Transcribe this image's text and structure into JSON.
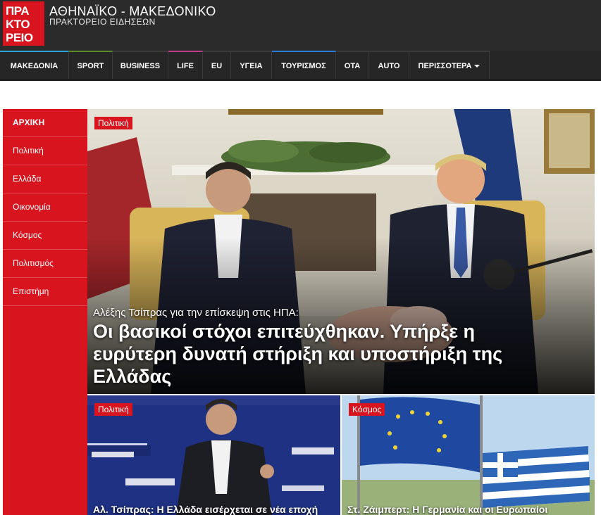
{
  "header": {
    "logo_lines": [
      "ΠΡΑ",
      "ΚΤΟ",
      "ΡΕΙΟ"
    ],
    "title": "ΑΘΗΝΑΪΚΟ - ΜΑΚΕΔΟΝΙΚΟ",
    "subtitle": "ΠΡΑΚΤΟΡΕΙΟ ΕΙΔΗΣΕΩΝ"
  },
  "nav": {
    "items": [
      {
        "label": "ΜΑΚΕΔΟΝΙΑ",
        "accent": "#2aa4d8"
      },
      {
        "label": "SPORT",
        "accent": "#5a8d2a"
      },
      {
        "label": "BUSINESS",
        "accent": "#3a3a3a"
      },
      {
        "label": "LIFE",
        "accent": "#c23a8a"
      },
      {
        "label": "EU",
        "accent": "#3a3a3a"
      },
      {
        "label": "ΥΓΕΙΑ",
        "accent": "#3a3a3a"
      },
      {
        "label": "ΤΟΥΡΙΣΜΟΣ",
        "accent": "#2a7ad8"
      },
      {
        "label": "ΟΤΑ",
        "accent": "#3a3a3a"
      },
      {
        "label": "AUTO",
        "accent": "#3a3a3a"
      },
      {
        "label": "ΠΕΡΙΣΣΟΤΕΡΑ",
        "accent": "#3a3a3a"
      }
    ]
  },
  "sidebar": {
    "items": [
      {
        "label": "ΑΡΧΙΚΗ"
      },
      {
        "label": "Πολιτική"
      },
      {
        "label": "Ελλάδα"
      },
      {
        "label": "Οικονομία"
      },
      {
        "label": "Κόσμος"
      },
      {
        "label": "Πολιτισμός"
      },
      {
        "label": "Επιστήμη"
      }
    ]
  },
  "hero": {
    "tag": "Πολιτική",
    "kicker": "Αλέξης Τσίπρας για την επίσκεψη στις ΗΠΑ:",
    "title": "Οι βασικοί στόχοι επιτεύχθηκαν. Υπήρξε η ευρύτερη δυνατή στήριξη και υποστήριξη της Ελλάδας"
  },
  "cards": [
    {
      "tag": "Πολιτική",
      "title": "Αλ. Τσίπρας: Η Ελλάδα εισέρχεται σε νέα εποχή"
    },
    {
      "tag": "Κόσμος",
      "title": "Στ. Ζάιμπερτ: Η Γερμανία και οι Ευρωπαίοι"
    }
  ],
  "colors": {
    "brand_red": "#d8151f",
    "header_bg": "#2b2b2b",
    "nav_bg": "#262626"
  }
}
